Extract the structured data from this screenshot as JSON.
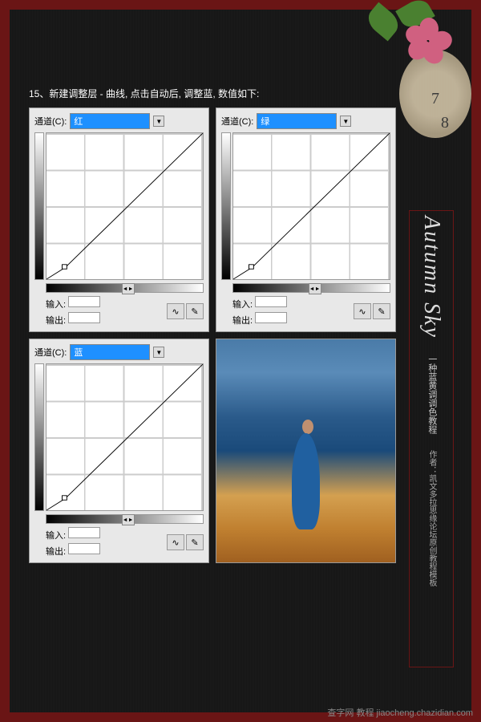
{
  "instruction": "15、新建调整层 - 曲线, 点击自动后, 调整蓝, 数值如下:",
  "panels": [
    {
      "channel_label": "通道(C):",
      "channel_value": "红",
      "input_label": "输入:",
      "output_label": "输出:"
    },
    {
      "channel_label": "通道(C):",
      "channel_value": "绿",
      "input_label": "输入:",
      "output_label": "输出:"
    },
    {
      "channel_label": "通道(C):",
      "channel_value": "蓝",
      "input_label": "输入:",
      "output_label": "输出:"
    }
  ],
  "sidebar": {
    "title": "Autumn Sky",
    "subtitle": "一种蓝黄调调色教程",
    "author_label": "作者：凯文多拉",
    "source": "思缘论坛原创教程模板"
  },
  "clock": {
    "num7": "7",
    "num8": "8"
  },
  "watermark": "查字网 教程 jiaocheng.chazidian.com",
  "chart_data": [
    {
      "type": "line",
      "title": "Curves - Red Channel",
      "xlabel": "Input",
      "ylabel": "Output",
      "xlim": [
        0,
        255
      ],
      "ylim": [
        0,
        255
      ],
      "series": [
        {
          "name": "红",
          "x": [
            0,
            30,
            255
          ],
          "y": [
            0,
            20,
            255
          ]
        }
      ]
    },
    {
      "type": "line",
      "title": "Curves - Green Channel",
      "xlabel": "Input",
      "ylabel": "Output",
      "xlim": [
        0,
        255
      ],
      "ylim": [
        0,
        255
      ],
      "series": [
        {
          "name": "绿",
          "x": [
            0,
            30,
            255
          ],
          "y": [
            0,
            20,
            255
          ]
        }
      ]
    },
    {
      "type": "line",
      "title": "Curves - Blue Channel",
      "xlabel": "Input",
      "ylabel": "Output",
      "xlim": [
        0,
        255
      ],
      "ylim": [
        0,
        255
      ],
      "series": [
        {
          "name": "蓝",
          "x": [
            0,
            30,
            255
          ],
          "y": [
            0,
            20,
            255
          ]
        }
      ]
    }
  ]
}
